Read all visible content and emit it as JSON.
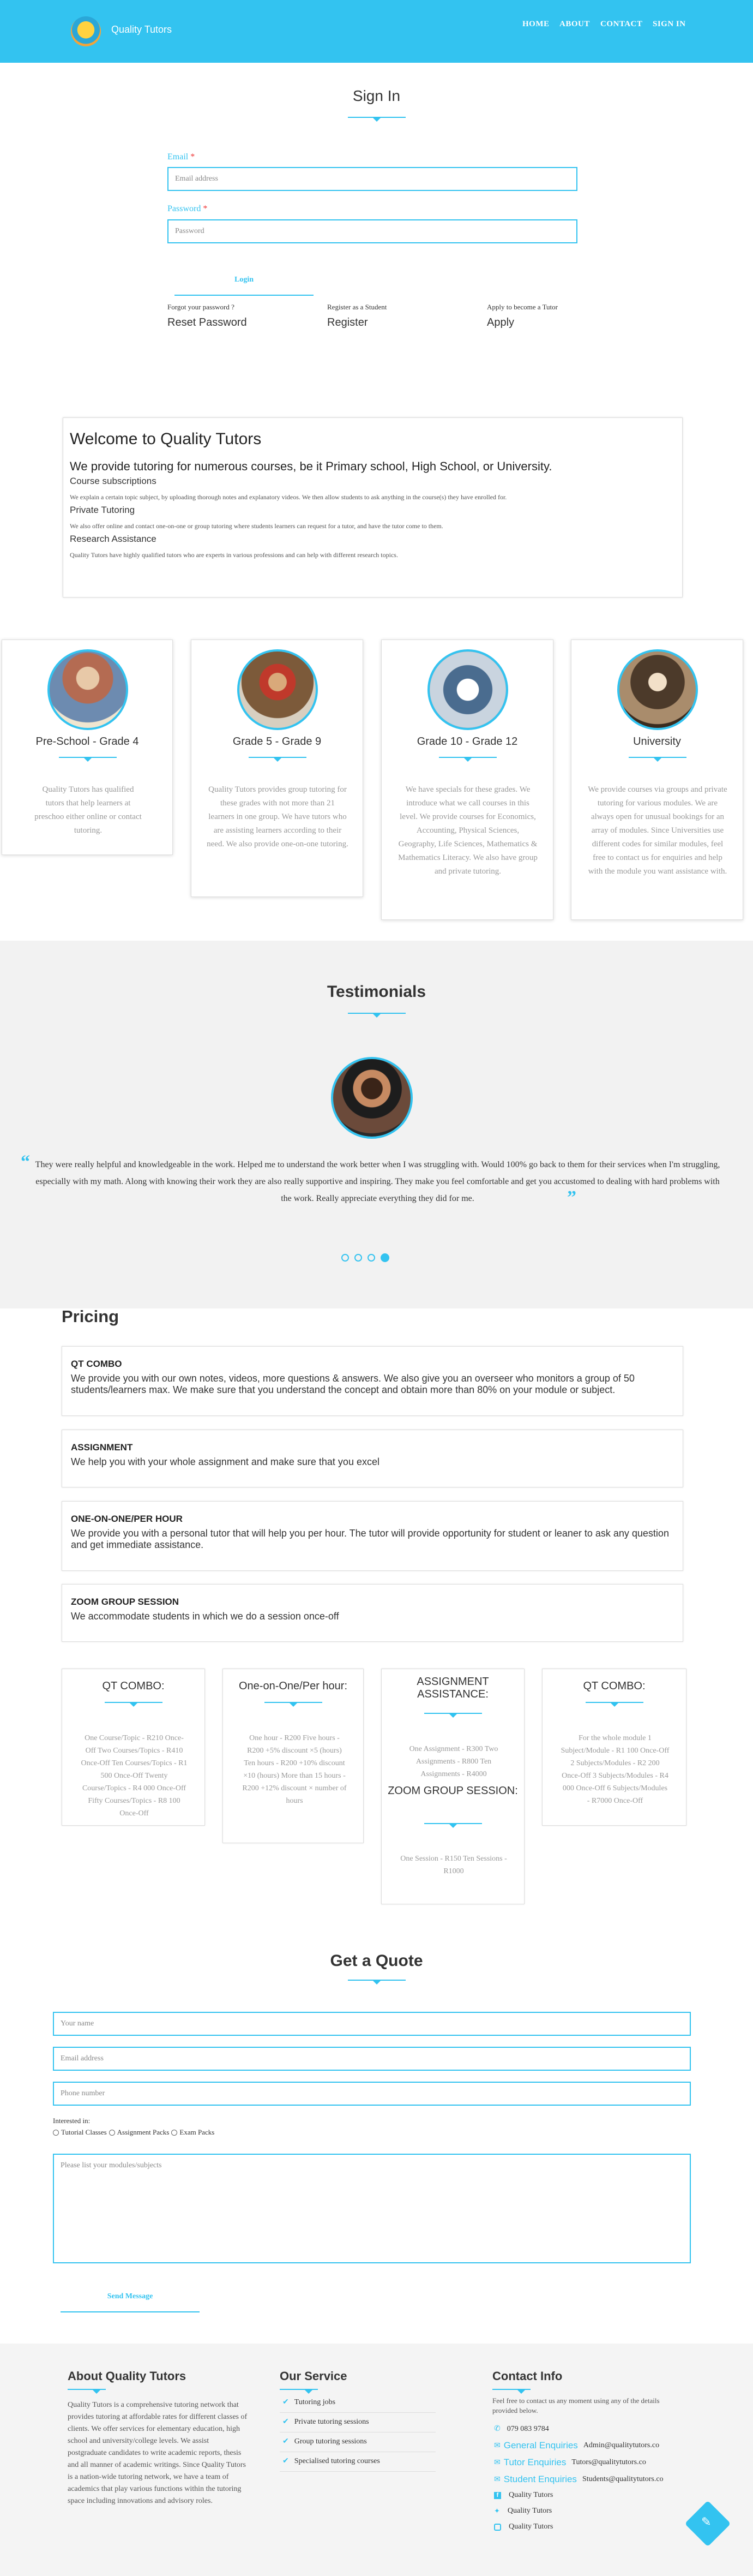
{
  "header": {
    "brand": "Quality Tutors",
    "nav": [
      "HOME",
      "ABOUT",
      "CONTACT",
      "SIGN IN"
    ]
  },
  "signin": {
    "title": "Sign In",
    "email_label": "Email",
    "email_placeholder": "Email address",
    "password_label": "Password",
    "password_placeholder": "Password",
    "required_mark": "*",
    "login_label": "Login",
    "links": [
      {
        "caption": "Forgot your password ?",
        "action": "Reset Password"
      },
      {
        "caption": "Register as a Student",
        "action": "Register"
      },
      {
        "caption": "Apply to become a Tutor",
        "action": "Apply"
      }
    ]
  },
  "welcome": {
    "title": "Welcome to Quality Tutors",
    "lead": "We provide tutoring for numerous courses, be it Primary school, High School, or University.",
    "items": [
      {
        "heading": "Course subscriptions",
        "text": "We explain a certain topic subject, by uploading thorough notes and explanatory videos. We then allow students to ask anything in the course(s) they have enrolled for."
      },
      {
        "heading": "Private Tutoring",
        "text": "We also offer online and contact one-on-one or group tutoring where students learners can request for a tutor, and have the tutor come to them."
      },
      {
        "heading": "Research Assistance",
        "text": "Quality Tutors have highly qualified tutors who are experts in various professions and can help with different research topics."
      }
    ]
  },
  "levels": [
    {
      "title": "Pre-School - Grade 4",
      "text": "Quality Tutors has qualified tutors that help learners at preschoo either online or contact tutoring."
    },
    {
      "title": "Grade 5 - Grade 9",
      "text": "Quality Tutors provides group tutoring for these grades with not more than 21 learners in one group. We have tutors who are assisting learners according to their need. We also provide one-on-one tutoring."
    },
    {
      "title": "Grade 10 - Grade 12",
      "text": "We have specials for these grades. We introduce what we call courses in this level. We provide courses for Economics, Accounting, Physical Sciences, Geography, Life Sciences, Mathematics & Mathematics Literacy. We also have group and private tutoring."
    },
    {
      "title": "University",
      "text": "We provide courses via groups and private tutoring for various modules. We are always open for unusual bookings for an array of modules. Since Universities use different codes for similar modules, feel free to contact us for enquiries and help with the module you want assistance with."
    }
  ],
  "testimonials": {
    "title": "Testimonials",
    "quote": "They were really helpful and knowledgeable in the work. Helped me to understand the work better when I was struggling with. Would 100% go back to them for their services when I'm struggling, especially with my math. Along with knowing their work they are also really supportive and inspiring. They make you feel comfortable and get you accustomed to dealing with hard problems with the work. Really appreciate everything they did for me.",
    "dots": 4,
    "active_dot": 4
  },
  "pricing": {
    "title": "Pricing",
    "boxes": [
      {
        "title": "QT COMBO",
        "text": "We provide you with our own notes, videos, more questions & answers. We also give you an overseer who monitors a group of 50 students/learners max. We make sure that you understand the concept and obtain more than 80% on your module or subject."
      },
      {
        "title": "ASSIGNMENT",
        "text": "We help you with your whole assignment and make sure that you excel"
      },
      {
        "title": "ONE-ON-ONE/PER HOUR",
        "text": "We provide you with a personal tutor that will help you per hour. The tutor will provide opportunity for student or leaner to ask any question and get immediate assistance."
      },
      {
        "title": "ZOOM GROUP SESSION",
        "text": "We accommodate students in which we do a session once-off"
      }
    ],
    "cards": [
      {
        "title": "QT COMBO:",
        "text": "One Course/Topic - R210 Once-Off Two Courses/Topics - R410 Once-Off Ten Courses/Topics - R1 500 Once-Off Twenty Course/Topics - R4 000 Once-Off Fifty Courses/Topics - R8 100 Once-Off"
      },
      {
        "title": "One-on-One/Per hour:",
        "text": "One hour - R200 Five hours - R200 +5% discount ×5 (hours) Ten hours - R200 +10% discount ×10 (hours) More than 15 hours - R200 +12% discount × number of hours"
      },
      {
        "title": "ASSIGNMENT ASSISTANCE:",
        "text": "One Assignment - R300 Two Assignments - R800 Ten Assignments - R4000",
        "title2": "ZOOM GROUP SESSION:",
        "text2": "One Session - R150 Ten Sessions - R1000"
      },
      {
        "title": "QT COMBO:",
        "text": "For the whole module 1 Subject/Module - R1 100 Once-Off 2 Subjects/Modules - R2 200 Once-Off 3 Subjects/Modules - R4 000 Once-Off 6 Subjects/Modules - R7000 Once-Off"
      }
    ]
  },
  "quote": {
    "title": "Get a Quote",
    "name_placeholder": "Your name",
    "email_placeholder": "Email address",
    "phone_placeholder": "Phone number",
    "interested_label": "Interested in:",
    "options": [
      "Tutorial Classes",
      "Assignment Packs",
      "Exam Packs"
    ],
    "message_placeholder": "Please list your modules/subjects",
    "send_label": "Send Message"
  },
  "footer": {
    "about_title": "About Quality Tutors",
    "about_text": "Quality Tutors is a comprehensive tutoring network that provides tutoring at affordable rates for different classes of clients. We offer services for elementary education, high school and university/college levels. We assist postgraduate candidates to write academic reports, thesis and all manner of academic writings. Since Quality Tutors is a nation-wide tutoring network, we have a team of academics that play various functions within the tutoring space including innovations and advisory roles.",
    "service_title": "Our Service",
    "services": [
      "Tutoring jobs",
      "Private tutoring sessions",
      "Group tutoring sessions",
      "Specialised tutoring courses"
    ],
    "contact_title": "Contact Info",
    "contact_intro": "Feel free to contact us any moment using any of the details provided below.",
    "phone": "079 083 9784",
    "emails": [
      {
        "label": "General Enquiries",
        "value": "Admin@qualitytutors.co"
      },
      {
        "label": "Tutor Enquiries",
        "value": "Tutors@qualitytutors.co"
      },
      {
        "label": "Student Enquiries",
        "value": "Students@qualitytutors.co"
      }
    ],
    "socials": [
      "Quality Tutors",
      "Quality Tutors",
      "Quality Tutors"
    ]
  },
  "colors": {
    "accent": "#33c3f0",
    "testimonial_bg": "#f2f2f2",
    "footer_bg": "#f4f4f4"
  },
  "icons": [
    "logo-icon",
    "quote-open-icon",
    "quote-close-icon",
    "phone-icon",
    "email-icon",
    "facebook-icon",
    "twitter-icon",
    "instagram-icon",
    "check-icon",
    "scroll-top-icon"
  ]
}
